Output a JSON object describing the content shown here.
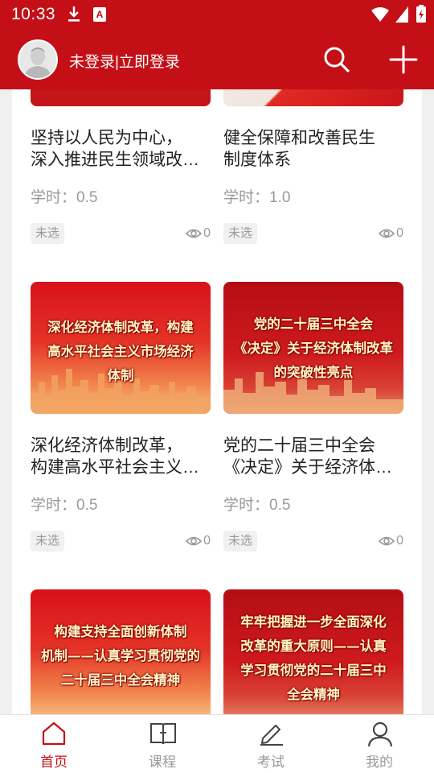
{
  "status_bar": {
    "time": "10:33"
  },
  "header": {
    "login_text": "未登录|立即登录"
  },
  "courses": [
    {
      "title_line1": "坚持以人民为中心，",
      "title_line2": "深入推进民生领域改…",
      "hours_label": "学时：0.5",
      "badge": "未选",
      "views": "0",
      "thumb_text": ""
    },
    {
      "title_line1": "健全保障和改善民生",
      "title_line2": "制度体系",
      "hours_label": "学时：1.0",
      "badge": "未选",
      "views": "0",
      "thumb_text": ""
    },
    {
      "title_line1": "深化经济体制改革，",
      "title_line2": "构建高水平社会主义…",
      "hours_label": "学时：0.5",
      "badge": "未选",
      "views": "0",
      "thumb_line1": "深化经济体制改革，构建",
      "thumb_line2": "高水平社会主义市场经济",
      "thumb_line3": "体制"
    },
    {
      "title_line1": "党的二十届三中全会",
      "title_line2": "《决定》关于经济体…",
      "hours_label": "学时：0.5",
      "badge": "未选",
      "views": "0",
      "thumb_line1": "党的二十届三中全会",
      "thumb_line2": "《决定》关于经济体制改革",
      "thumb_line3": "的突破性亮点"
    },
    {
      "thumb_line1": "构建支持全面创新体制",
      "thumb_line2": "机制——认真学习贯彻党的",
      "thumb_line3": "二十届三中全会精神"
    },
    {
      "thumb_line1": "牢牢把握进一步全面深化",
      "thumb_line2": "改革的重大原则——认真",
      "thumb_line3": "学习贯彻党的二十届三中",
      "thumb_line4": "全会精神"
    }
  ],
  "tabbar": {
    "items": [
      {
        "label": "首页",
        "icon": "home-icon",
        "active": true
      },
      {
        "label": "课程",
        "icon": "book-icon"
      },
      {
        "label": "考试",
        "icon": "pen-icon"
      },
      {
        "label": "我的",
        "icon": "user-icon"
      }
    ]
  },
  "colors": {
    "brand": "#c40f16",
    "muted": "#999999",
    "title": "#222222"
  }
}
